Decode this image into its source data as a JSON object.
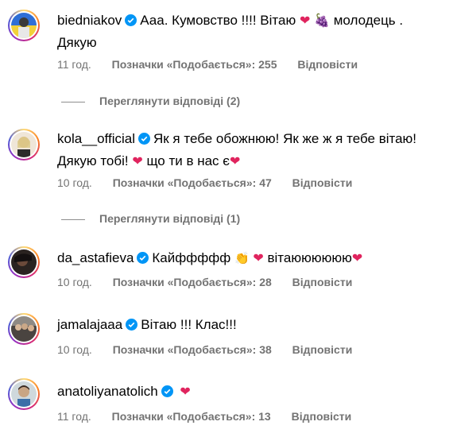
{
  "comments": [
    {
      "username": "biedniakov",
      "text_a": "Ааа. Кумовство !!!! Вітаю",
      "text_b": "молодець .",
      "text_c": "Дякую",
      "time": "11 год.",
      "likes": "Позначки «Подобається»: 255",
      "reply": "Відповісти",
      "view_replies": "Переглянути відповіді (2)"
    },
    {
      "username": "kola__official",
      "text_a": "Як я тебе обожнюю! Як же ж я тебе вітаю!",
      "text_b": "Дякую тобі!",
      "text_c": "що ти в нас є",
      "time": "10 год.",
      "likes": "Позначки «Подобається»: 47",
      "reply": "Відповісти",
      "view_replies": "Переглянути відповіді (1)"
    },
    {
      "username": "da_astafieva",
      "text_a": "Кайффффф",
      "text_b": "вітаюююююю",
      "time": "10 год.",
      "likes": "Позначки «Подобається»: 28",
      "reply": "Відповісти"
    },
    {
      "username": "jamalajaaa",
      "text_a": "Вітаю !!! Клас!!!",
      "time": "10 год.",
      "likes": "Позначки «Подобається»: 38",
      "reply": "Відповісти"
    },
    {
      "username": "anatoliyanatolich",
      "time": "11 год.",
      "likes": "Позначки «Подобається»: 13",
      "reply": "Відповісти"
    }
  ],
  "icons": {
    "verified": "verified-badge-icon",
    "heart": "heart-emoji-icon",
    "grapes": "grapes-emoji-icon",
    "clap": "clap-emoji-icon"
  },
  "colors": {
    "verified": "#0095f6",
    "heart": "#e0245e",
    "meta": "#737373"
  }
}
